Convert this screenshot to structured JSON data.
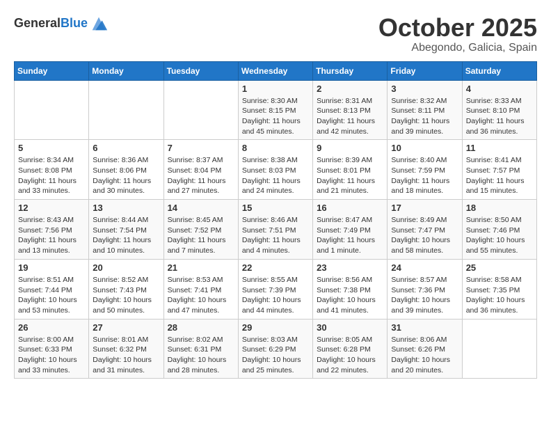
{
  "header": {
    "logo_general": "General",
    "logo_blue": "Blue",
    "month_title": "October 2025",
    "location": "Abegondo, Galicia, Spain"
  },
  "weekdays": [
    "Sunday",
    "Monday",
    "Tuesday",
    "Wednesday",
    "Thursday",
    "Friday",
    "Saturday"
  ],
  "weeks": [
    [
      {
        "day": "",
        "info": ""
      },
      {
        "day": "",
        "info": ""
      },
      {
        "day": "",
        "info": ""
      },
      {
        "day": "1",
        "info": "Sunrise: 8:30 AM\nSunset: 8:15 PM\nDaylight: 11 hours\nand 45 minutes."
      },
      {
        "day": "2",
        "info": "Sunrise: 8:31 AM\nSunset: 8:13 PM\nDaylight: 11 hours\nand 42 minutes."
      },
      {
        "day": "3",
        "info": "Sunrise: 8:32 AM\nSunset: 8:11 PM\nDaylight: 11 hours\nand 39 minutes."
      },
      {
        "day": "4",
        "info": "Sunrise: 8:33 AM\nSunset: 8:10 PM\nDaylight: 11 hours\nand 36 minutes."
      }
    ],
    [
      {
        "day": "5",
        "info": "Sunrise: 8:34 AM\nSunset: 8:08 PM\nDaylight: 11 hours\nand 33 minutes."
      },
      {
        "day": "6",
        "info": "Sunrise: 8:36 AM\nSunset: 8:06 PM\nDaylight: 11 hours\nand 30 minutes."
      },
      {
        "day": "7",
        "info": "Sunrise: 8:37 AM\nSunset: 8:04 PM\nDaylight: 11 hours\nand 27 minutes."
      },
      {
        "day": "8",
        "info": "Sunrise: 8:38 AM\nSunset: 8:03 PM\nDaylight: 11 hours\nand 24 minutes."
      },
      {
        "day": "9",
        "info": "Sunrise: 8:39 AM\nSunset: 8:01 PM\nDaylight: 11 hours\nand 21 minutes."
      },
      {
        "day": "10",
        "info": "Sunrise: 8:40 AM\nSunset: 7:59 PM\nDaylight: 11 hours\nand 18 minutes."
      },
      {
        "day": "11",
        "info": "Sunrise: 8:41 AM\nSunset: 7:57 PM\nDaylight: 11 hours\nand 15 minutes."
      }
    ],
    [
      {
        "day": "12",
        "info": "Sunrise: 8:43 AM\nSunset: 7:56 PM\nDaylight: 11 hours\nand 13 minutes."
      },
      {
        "day": "13",
        "info": "Sunrise: 8:44 AM\nSunset: 7:54 PM\nDaylight: 11 hours\nand 10 minutes."
      },
      {
        "day": "14",
        "info": "Sunrise: 8:45 AM\nSunset: 7:52 PM\nDaylight: 11 hours\nand 7 minutes."
      },
      {
        "day": "15",
        "info": "Sunrise: 8:46 AM\nSunset: 7:51 PM\nDaylight: 11 hours\nand 4 minutes."
      },
      {
        "day": "16",
        "info": "Sunrise: 8:47 AM\nSunset: 7:49 PM\nDaylight: 11 hours\nand 1 minute."
      },
      {
        "day": "17",
        "info": "Sunrise: 8:49 AM\nSunset: 7:47 PM\nDaylight: 10 hours\nand 58 minutes."
      },
      {
        "day": "18",
        "info": "Sunrise: 8:50 AM\nSunset: 7:46 PM\nDaylight: 10 hours\nand 55 minutes."
      }
    ],
    [
      {
        "day": "19",
        "info": "Sunrise: 8:51 AM\nSunset: 7:44 PM\nDaylight: 10 hours\nand 53 minutes."
      },
      {
        "day": "20",
        "info": "Sunrise: 8:52 AM\nSunset: 7:43 PM\nDaylight: 10 hours\nand 50 minutes."
      },
      {
        "day": "21",
        "info": "Sunrise: 8:53 AM\nSunset: 7:41 PM\nDaylight: 10 hours\nand 47 minutes."
      },
      {
        "day": "22",
        "info": "Sunrise: 8:55 AM\nSunset: 7:39 PM\nDaylight: 10 hours\nand 44 minutes."
      },
      {
        "day": "23",
        "info": "Sunrise: 8:56 AM\nSunset: 7:38 PM\nDaylight: 10 hours\nand 41 minutes."
      },
      {
        "day": "24",
        "info": "Sunrise: 8:57 AM\nSunset: 7:36 PM\nDaylight: 10 hours\nand 39 minutes."
      },
      {
        "day": "25",
        "info": "Sunrise: 8:58 AM\nSunset: 7:35 PM\nDaylight: 10 hours\nand 36 minutes."
      }
    ],
    [
      {
        "day": "26",
        "info": "Sunrise: 8:00 AM\nSunset: 6:33 PM\nDaylight: 10 hours\nand 33 minutes."
      },
      {
        "day": "27",
        "info": "Sunrise: 8:01 AM\nSunset: 6:32 PM\nDaylight: 10 hours\nand 31 minutes."
      },
      {
        "day": "28",
        "info": "Sunrise: 8:02 AM\nSunset: 6:31 PM\nDaylight: 10 hours\nand 28 minutes."
      },
      {
        "day": "29",
        "info": "Sunrise: 8:03 AM\nSunset: 6:29 PM\nDaylight: 10 hours\nand 25 minutes."
      },
      {
        "day": "30",
        "info": "Sunrise: 8:05 AM\nSunset: 6:28 PM\nDaylight: 10 hours\nand 22 minutes."
      },
      {
        "day": "31",
        "info": "Sunrise: 8:06 AM\nSunset: 6:26 PM\nDaylight: 10 hours\nand 20 minutes."
      },
      {
        "day": "",
        "info": ""
      }
    ]
  ]
}
